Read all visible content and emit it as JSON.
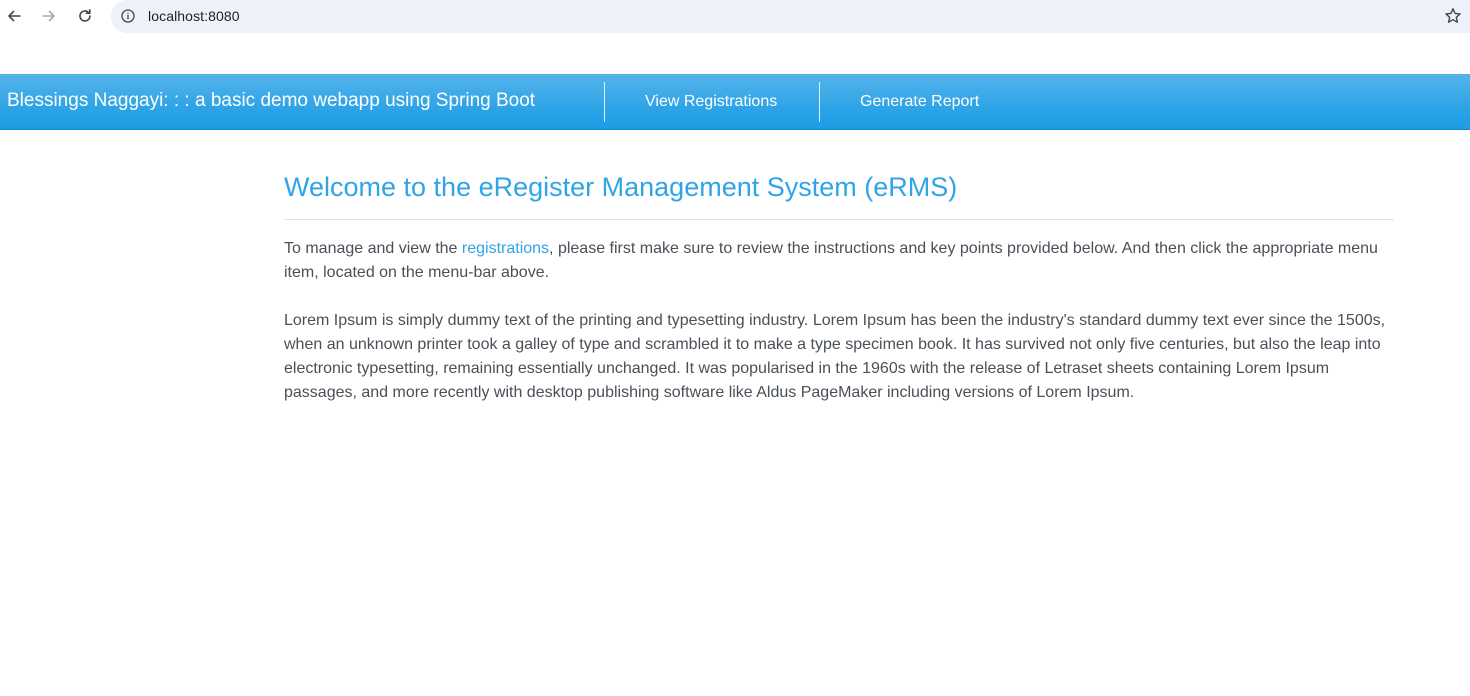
{
  "browser": {
    "url": "localhost:8080",
    "icons": [
      "back-arrow-icon",
      "forward-arrow-icon",
      "reload-icon",
      "site-info-icon",
      "bookmark-star-icon"
    ]
  },
  "navbar": {
    "brand": "Blessings Naggayi: : : a basic demo webapp using Spring Boot",
    "links": [
      {
        "label": "View Registrations"
      },
      {
        "label": "Generate Report"
      }
    ],
    "color": "#2fa4e7"
  },
  "main": {
    "title": "Welcome to the eRegister Management System (eRMS)",
    "intro": {
      "before_link": "To manage and view the ",
      "link_text": "registrations",
      "after_link": ", please first make sure to review the instructions and key points provided below. And then click the appropriate menu item, located on the menu-bar above."
    },
    "body_text": "Lorem Ipsum is simply dummy text of the printing and typesetting industry. Lorem Ipsum has been the industry's standard dummy text ever since the 1500s, when an unknown printer took a galley of type and scrambled it to make a type specimen book. It has survived not only five centuries, but also the leap into electronic typesetting, remaining essentially unchanged. It was popularised in the 1960s with the release of Letraset sheets containing Lorem Ipsum passages, and more recently with desktop publishing software like Aldus PageMaker including versions of Lorem Ipsum."
  }
}
